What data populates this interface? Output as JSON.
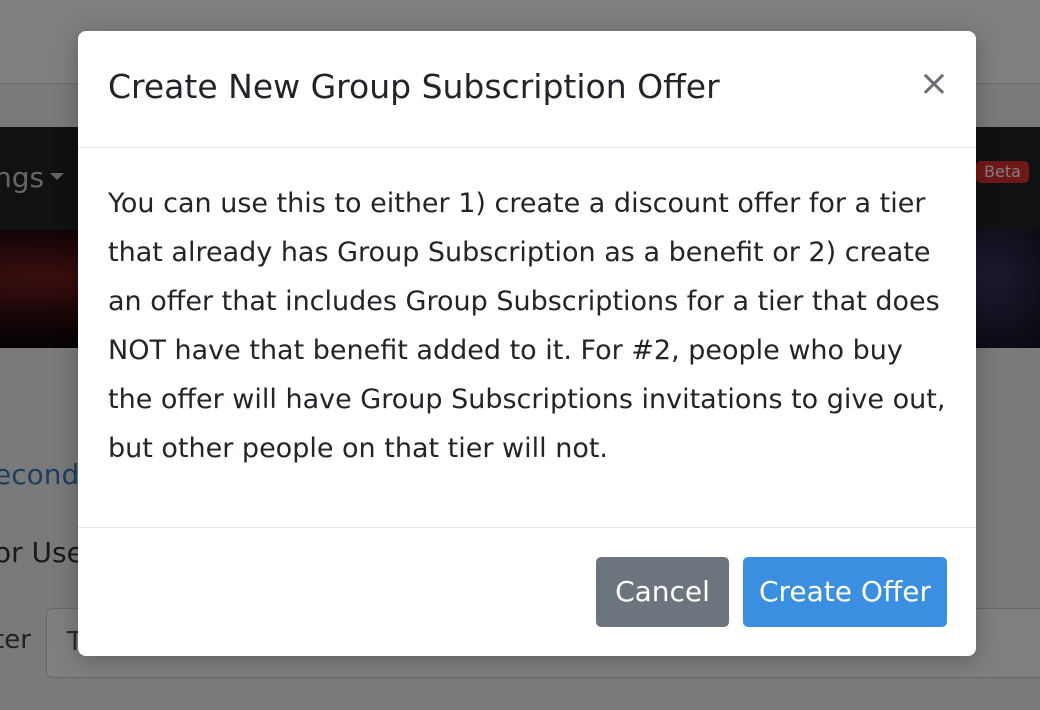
{
  "background": {
    "nav_item_label": "ngs",
    "beta_badge": "Beta",
    "link_text": "econd",
    "field_label": "or Use",
    "input_label": "ter",
    "input_value": "T"
  },
  "modal": {
    "title": "Create New Group Subscription Offer",
    "close_glyph": "×",
    "body_text": "You can use this to either 1) create a discount offer for a tier that already has Group Subscription as a benefit or 2) create an offer that includes Group Subscriptions for a tier that does NOT have that benefit added to it. For #2, people who buy the offer will have Group Subscriptions invitations to give out, but other people on that tier will not.",
    "cancel_label": "Cancel",
    "create_label": "Create Offer"
  },
  "colors": {
    "primary": "#3a8fe0",
    "secondary": "#6c757d",
    "badge": "#e03131"
  }
}
